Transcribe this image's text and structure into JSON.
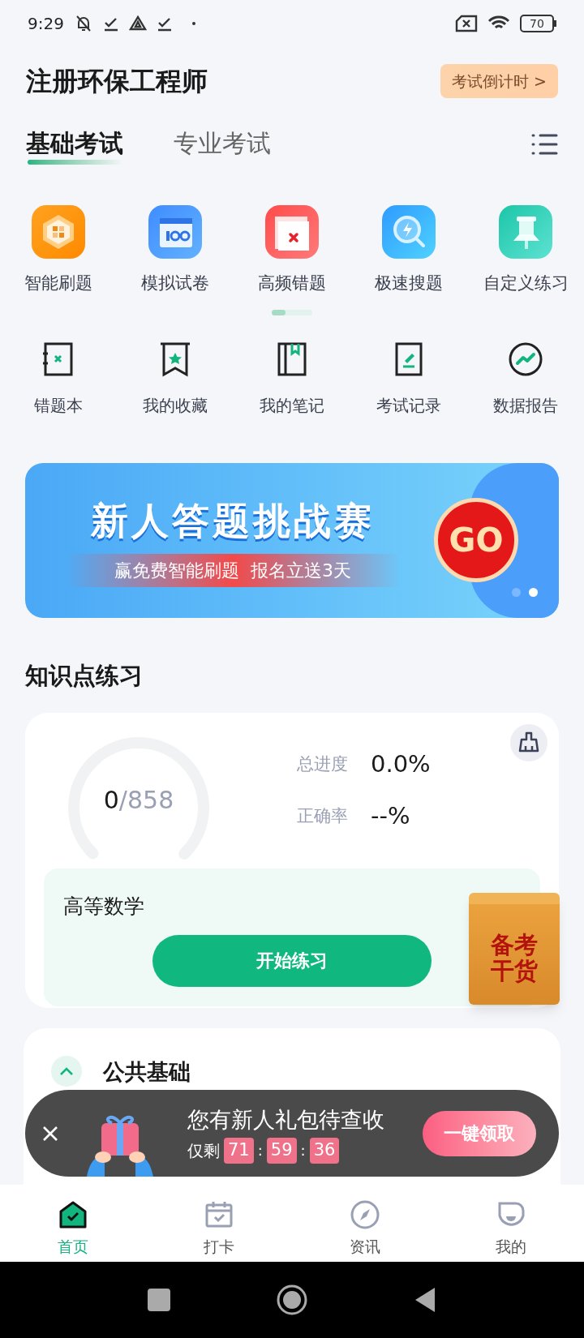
{
  "status_bar": {
    "time": "9:29",
    "battery": "70"
  },
  "header": {
    "title": "注册环保工程师",
    "countdown_button": "考试倒计时 >"
  },
  "tabs": [
    {
      "label": "基础考试",
      "selected": true
    },
    {
      "label": "专业考试",
      "selected": false
    }
  ],
  "features": [
    {
      "label": "智能刷题"
    },
    {
      "label": "模拟试卷"
    },
    {
      "label": "高频错题"
    },
    {
      "label": "极速搜题"
    },
    {
      "label": "自定义练习"
    }
  ],
  "tools": [
    {
      "label": "错题本"
    },
    {
      "label": "我的收藏"
    },
    {
      "label": "我的笔记"
    },
    {
      "label": "考试记录"
    },
    {
      "label": "数据报告"
    }
  ],
  "banner": {
    "title": "新人答题挑战赛",
    "subtitle_1": "赢免费智能刷题",
    "subtitle_2": "报名立送3天",
    "go": "GO",
    "dots": [
      {
        "selected": false
      },
      {
        "selected": true
      }
    ]
  },
  "section_title": "知识点练习",
  "progress_card": {
    "done": "0",
    "total": "/858",
    "progress_label": "总进度",
    "progress_value": "0.0%",
    "accuracy_label": "正确率",
    "accuracy_value": "--%",
    "subject": "高等数学",
    "start_button": "开始练习"
  },
  "floating_badge": {
    "lines": [
      "备考",
      "干货"
    ]
  },
  "chapter_card": {
    "title": "公共基础",
    "expanded": true
  },
  "gift_popup": {
    "title": "您有新人礼包待查收",
    "remaining_label": "仅剩",
    "countdown": [
      {
        "kind": "digits",
        "text": "71"
      },
      {
        "kind": "sep",
        "text": ":"
      },
      {
        "kind": "digits",
        "text": "59"
      },
      {
        "kind": "sep",
        "text": ":"
      },
      {
        "kind": "digits",
        "text": "36"
      }
    ],
    "claim_button": "一键领取"
  },
  "bottom_nav": [
    {
      "label": "首页",
      "selected": true
    },
    {
      "label": "打卡",
      "selected": false
    },
    {
      "label": "资讯",
      "selected": false
    },
    {
      "label": "我的",
      "selected": false
    }
  ]
}
